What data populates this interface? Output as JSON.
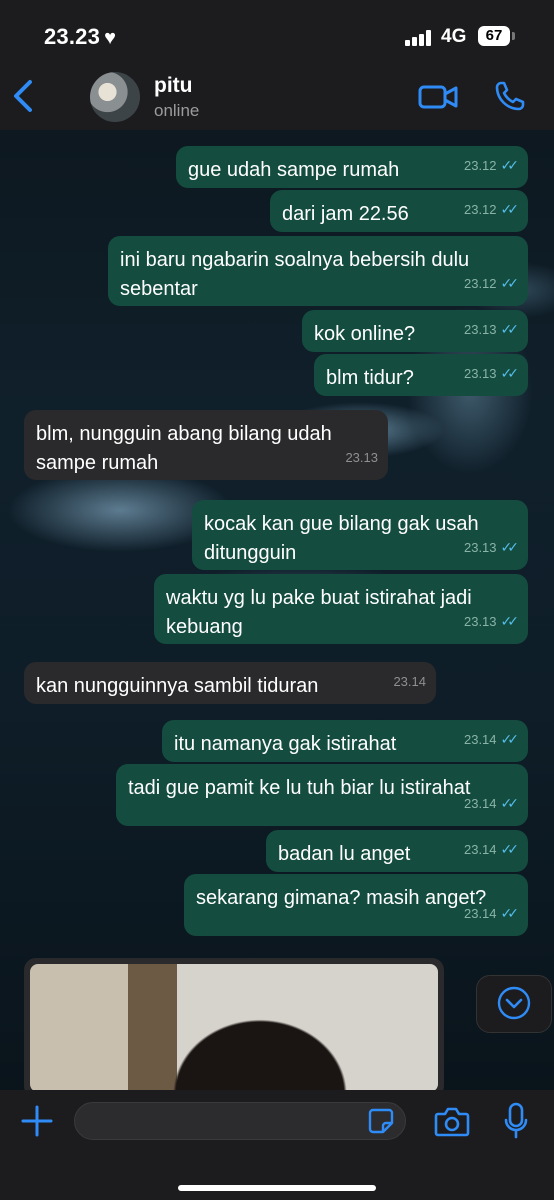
{
  "status": {
    "time": "23.23",
    "heart": "♥",
    "network": "4G",
    "battery": "67"
  },
  "contact": {
    "name": "pitu",
    "presence": "online"
  },
  "messages": [
    {
      "side": "out",
      "text": "gue udah sampe rumah",
      "time": "23.12",
      "read": true
    },
    {
      "side": "out",
      "text": "dari jam 22.56",
      "time": "23.12",
      "read": true
    },
    {
      "side": "out",
      "text": "ini baru ngabarin soalnya bebersih dulu sebentar",
      "time": "23.12",
      "read": true
    },
    {
      "side": "out",
      "text": "kok online?",
      "time": "23.13",
      "read": true
    },
    {
      "side": "out",
      "text": "blm tidur?",
      "time": "23.13",
      "read": true
    },
    {
      "side": "in",
      "text": "blm, nungguin abang bilang udah sampe rumah",
      "time": "23.13"
    },
    {
      "side": "out",
      "text": "kocak kan gue bilang gak usah ditungguin",
      "time": "23.13",
      "read": true
    },
    {
      "side": "out",
      "text": "waktu yg lu pake buat istirahat jadi kebuang",
      "time": "23.13",
      "read": true
    },
    {
      "side": "in",
      "text": "kan nungguinnya sambil tiduran",
      "time": "23.14"
    },
    {
      "side": "out",
      "text": "itu namanya gak istirahat",
      "time": "23.14",
      "read": true
    },
    {
      "side": "out",
      "text": "tadi gue pamit ke lu tuh biar lu istirahat",
      "time": "23.14",
      "read": true
    },
    {
      "side": "out",
      "text": "badan lu anget",
      "time": "23.14",
      "read": true
    },
    {
      "side": "out",
      "text": "sekarang gimana? masih anget?",
      "time": "23.14",
      "read": true
    }
  ],
  "colors": {
    "outgoing": "#144d3f",
    "incoming": "#2a2a2c",
    "accent": "#2f8bf5",
    "read_tick": "#53bdeb"
  },
  "icons": {
    "back": "chevron-left-icon",
    "video": "video-camera-icon",
    "call": "phone-icon",
    "scroll": "chevron-down-circle-icon",
    "attach": "plus-icon",
    "sticker": "sticker-icon",
    "camera": "camera-icon",
    "mic": "microphone-icon"
  }
}
